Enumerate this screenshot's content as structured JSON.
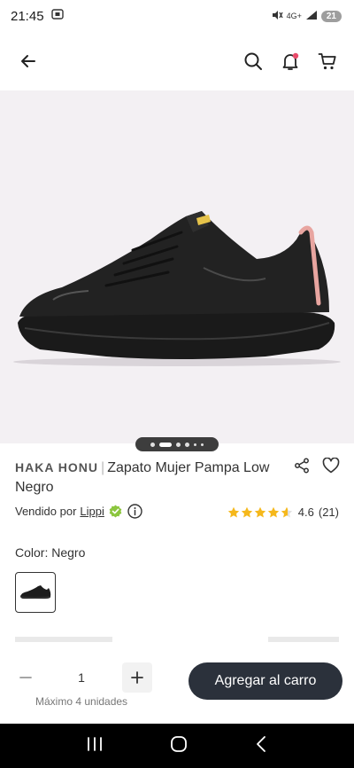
{
  "status_bar": {
    "time": "21:45",
    "network": "4G+",
    "battery": "21"
  },
  "nav": {
    "back_icon": "arrow-left-icon",
    "search_icon": "search-icon",
    "notifications_icon": "bell-icon",
    "cart_icon": "cart-icon"
  },
  "product": {
    "brand": "HAKA HONU",
    "separator": "|",
    "title": "Zapato Mujer Pampa Low Negro",
    "image_alt": "Zapato negro Haka Honu Pampa Low",
    "carousel": {
      "total_dots": 5,
      "active_index": 0
    }
  },
  "seller": {
    "prefix": "Vendido por",
    "name": "Lippi"
  },
  "rating": {
    "value": "4.6",
    "count": "(21)",
    "stars": 4.6
  },
  "color": {
    "label": "Color:",
    "value": "Negro"
  },
  "purchase": {
    "quantity": "1",
    "max_note": "Máximo 4 unidades",
    "add_to_cart": "Agregar al carro"
  },
  "colors": {
    "cart_button": "#2b313b",
    "star": "#f5b81c",
    "verified": "#8cc63f",
    "bell_dot": "#e94b6a"
  }
}
